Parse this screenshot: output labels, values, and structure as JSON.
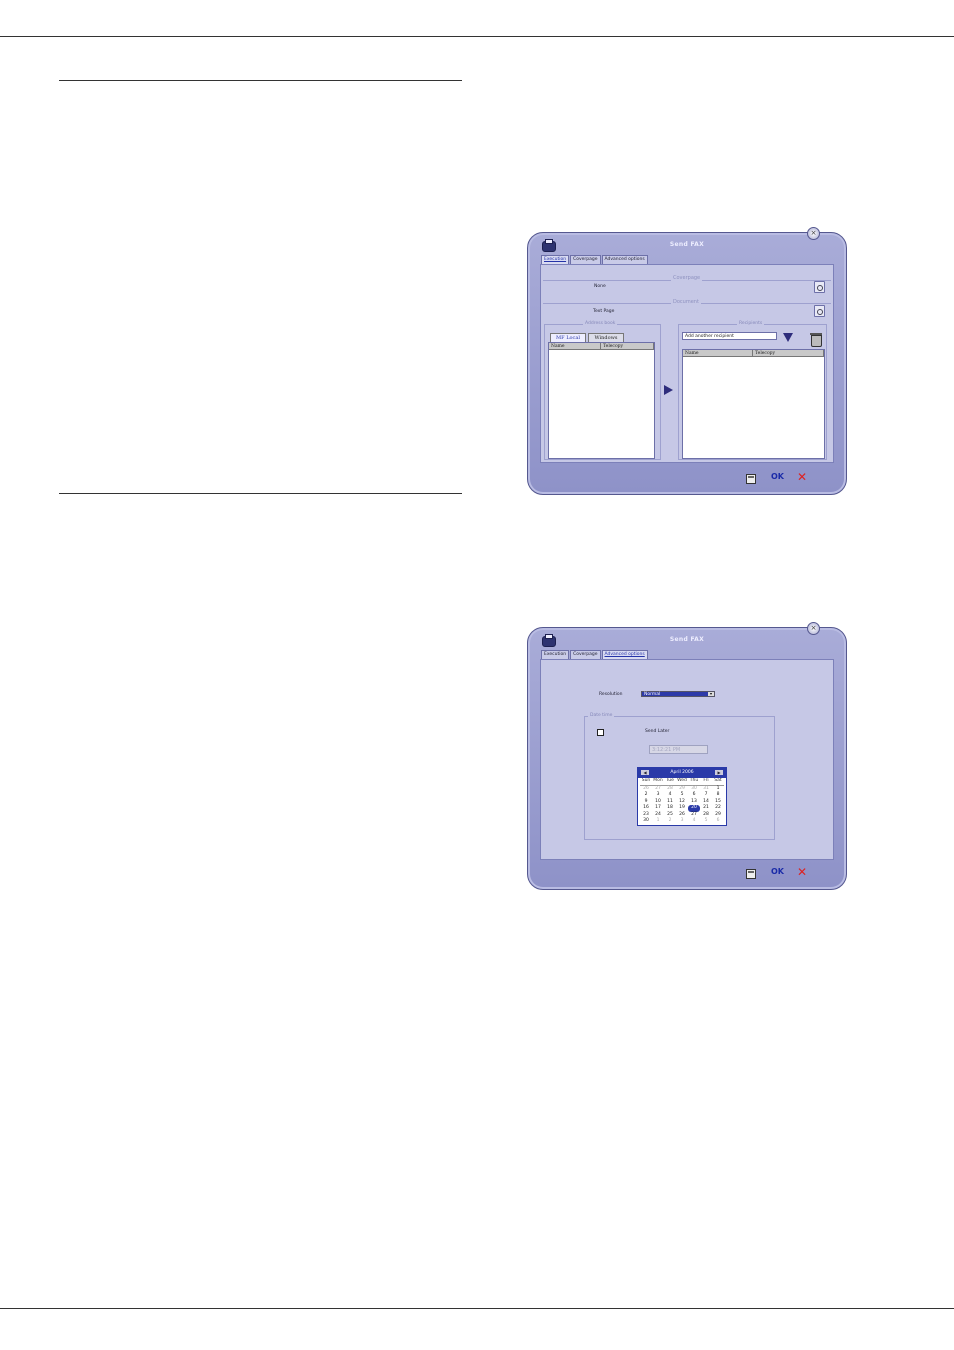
{
  "window1": {
    "title": "Send FAX",
    "tabs": [
      "Execution",
      "Coverpage",
      "Advanced options"
    ],
    "coverpage_group": "Coverpage",
    "coverpage_value": "None",
    "document_group": "Document",
    "document_value": "Text Page",
    "addressbook_group": "Address book",
    "addressbook_tabs": [
      "MF Local",
      "Windows"
    ],
    "addressbook_columns": [
      "Name",
      "Telecopy"
    ],
    "recipients_group": "Recipients",
    "recipient_input": "Add another recipient",
    "recipients_columns": [
      "Name",
      "Telecopy"
    ],
    "ok_label": "OK",
    "cancel_label": "✕"
  },
  "window2": {
    "title": "Send FAX",
    "tabs": [
      "Execution",
      "Coverpage",
      "Advanced options"
    ],
    "resolution_label": "Resolution",
    "resolution_value": "Normal",
    "datetime_group": "Date time",
    "send_later_label": "Send Later",
    "time_value": "3:12:21 PM",
    "calendar": {
      "month_year": "April 2006",
      "prev": "◀",
      "next": "▶",
      "day_names": [
        "Sun",
        "Mon",
        "Tue",
        "Wed",
        "Thu",
        "Fri",
        "Sat"
      ],
      "days": [
        "26",
        "27",
        "28",
        "29",
        "30",
        "31",
        "1",
        "2",
        "3",
        "4",
        "5",
        "6",
        "7",
        "8",
        "9",
        "10",
        "11",
        "12",
        "13",
        "14",
        "15",
        "16",
        "17",
        "18",
        "19",
        "20",
        "21",
        "22",
        "23",
        "24",
        "25",
        "26",
        "27",
        "28",
        "29",
        "30",
        "1",
        "2",
        "3",
        "4",
        "5",
        "6"
      ],
      "today": "20"
    },
    "ok_label": "OK",
    "cancel_label": "✕"
  }
}
